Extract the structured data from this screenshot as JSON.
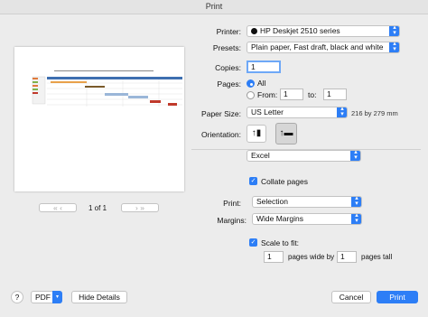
{
  "window": {
    "title": "Print"
  },
  "printer": {
    "label": "Printer:",
    "value": "HP Deskjet 2510 series"
  },
  "presets": {
    "label": "Presets:",
    "value": "Plain paper, Fast draft, black and white"
  },
  "copies": {
    "label": "Copies:",
    "value": "1"
  },
  "pages": {
    "label": "Pages:",
    "all_label": "All",
    "from_label": "From:",
    "from_value": "1",
    "to_label": "to:",
    "to_value": "1"
  },
  "paper_size": {
    "label": "Paper Size:",
    "value": "US Letter",
    "dimensions": "216 by 279 mm"
  },
  "orientation": {
    "label": "Orientation:"
  },
  "app_section": {
    "value": "Excel"
  },
  "collate": {
    "label": "Collate pages",
    "checked": true
  },
  "print_what": {
    "label": "Print:",
    "value": "Selection"
  },
  "margins": {
    "label": "Margins:",
    "value": "Wide Margins"
  },
  "scale": {
    "label": "Scale to fit:",
    "checked": true,
    "wide_value": "1",
    "wide_label": "pages wide by",
    "tall_value": "1",
    "tall_label": "pages tall"
  },
  "pager": {
    "text": "1 of 1"
  },
  "footer": {
    "help": "?",
    "pdf": "PDF",
    "hide_details": "Hide Details",
    "cancel": "Cancel",
    "print": "Print"
  },
  "colors": {
    "accent": "#2d7ef6"
  }
}
